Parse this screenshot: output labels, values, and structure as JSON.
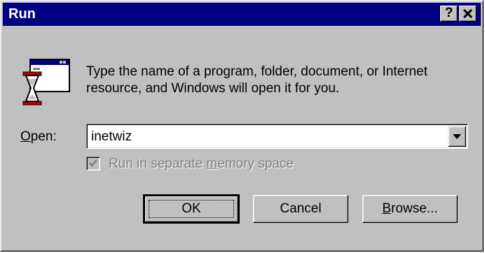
{
  "window": {
    "title": "Run",
    "help_button": "?",
    "close_button": "✖"
  },
  "description": "Type the name of a program, folder, document, or Internet resource, and Windows will open it for you.",
  "open": {
    "label_accel": "O",
    "label_rest": "pen:",
    "value": "inetwiz"
  },
  "checkbox": {
    "label_pre": "Run in separate ",
    "label_accel": "m",
    "label_post": "emory space",
    "checked": true,
    "enabled": false
  },
  "buttons": {
    "ok": "OK",
    "cancel": "Cancel",
    "browse_accel": "B",
    "browse_rest": "rowse..."
  }
}
